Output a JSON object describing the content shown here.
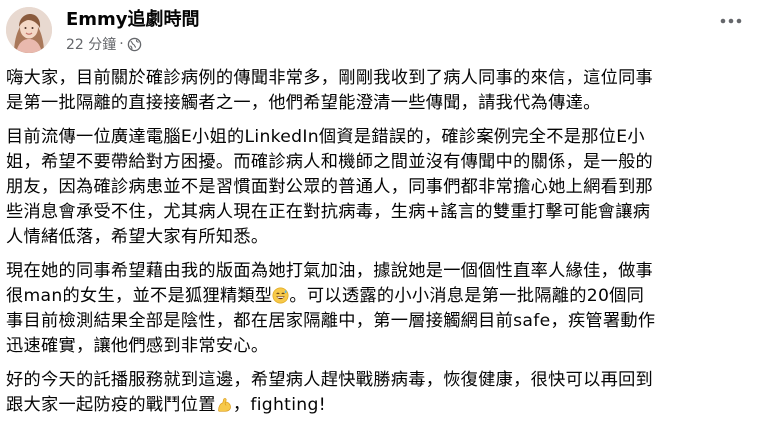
{
  "post": {
    "author": "Emmy追劇時間",
    "time": "22 分鐘",
    "separator": "·",
    "paragraphs": [
      {
        "lines": [
          "嗨大家，目前關於確診病例的傳聞非常多，剛剛我收到了病人同事的來信，這位同事",
          "是第一批隔離的直接接觸者之一，他們希望能澄清一些傳聞，請我代為傳達。"
        ]
      },
      {
        "lines": [
          "目前流傳一位廣達電腦E小姐的LinkedIn個資是錯誤的，確診案例完全不是那位E小",
          "姐，希望不要帶給對方困擾。而確診病人和機師之間並沒有傳聞中的關係，是一般的",
          "朋友，因為確診病患並不是習慣面對公眾的普通人，同事們都非常擔心她上網看到那",
          "些消息會承受不住，尤其病人現在正在對抗病毒，生病+謠言的雙重打擊可能會讓病",
          "人情緒低落，希望大家有所知悉。"
        ]
      },
      {
        "lines": [
          "現在她的同事希望藉由我的版面為她打氣加油，據說她是一個個性直率人緣佳，做事",
          "很man的女生，並不是狐狸精類型",
          "。可以透露的小小消息是第一批隔離的20個同",
          "事目前檢測結果全部是陰性，都在居家隔離中，第一層接觸網目前safe，疾管署動作",
          "迅速確實，讓他們感到非常安心。"
        ]
      },
      {
        "lines": [
          "好的今天的託播服務就到這邊，希望病人趕快戰勝病毒，恢復健康，很快可以再回到",
          "跟大家一起防疫的戰鬥位置",
          "，fighting!"
        ]
      }
    ]
  },
  "icons": {
    "globe": "globe-icon",
    "more": "more-options-icon",
    "laugh_emoji": "grinning-sweat-emoji-icon",
    "muscle_emoji": "flexed-biceps-emoji-icon"
  },
  "colors": {
    "text": "#050505",
    "secondary": "#65676b"
  }
}
